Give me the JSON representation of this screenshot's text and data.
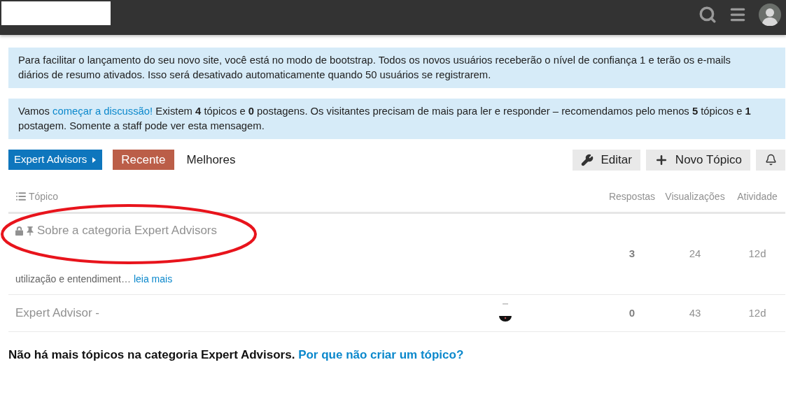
{
  "notices": [
    {
      "kind": "plain",
      "text": "Para facilitar o lançamento do seu novo site, você está no modo de bootstrap. Todos os novos usuários receberão o nível de confiança 1 e terão os e-mails diários de resumo ativados. Isso será desativado automaticamente quando 50 usuários se registrarem."
    },
    {
      "kind": "link",
      "before": "Vamos",
      "link": "começar a discussão!",
      "after": "Existem **4** tópicos e **0** postagens. Os visitantes precisam de mais para ler e responder – recomendamos pelo menos **5** tópicos e **1** postagem. Somente a staff pode ver esta mensagem."
    }
  ],
  "navigation": {
    "category": "Expert Advisors",
    "tabs": [
      {
        "label": "Recente",
        "selected": true
      },
      {
        "label": "Melhores",
        "selected": false
      }
    ],
    "actions": [
      {
        "kind": "edit",
        "label": "Editar"
      },
      {
        "kind": "create",
        "label": "Novo Tópico"
      },
      {
        "kind": "notifications"
      }
    ]
  },
  "table": {
    "columns": [
      "Tópico",
      "Respostas",
      "Visualizações",
      "Atividade"
    ],
    "rows": [
      {
        "title": "Sobre a categoria Expert Advisors",
        "locked": true,
        "pinned": true,
        "has_poster": false,
        "excerpt": "utilização e entendiment…",
        "excerpt_link": "leia mais",
        "replies": "3",
        "views": "24",
        "activity": "12d"
      },
      {
        "title": "Expert Advisor -",
        "locked": false,
        "pinned": false,
        "has_poster": true,
        "replies": "0",
        "views": "43",
        "activity": "12d"
      }
    ]
  },
  "footer": {
    "text": "Não há mais tópicos na categoria Expert Advisors.",
    "link": "Por que não criar um tópico?"
  }
}
